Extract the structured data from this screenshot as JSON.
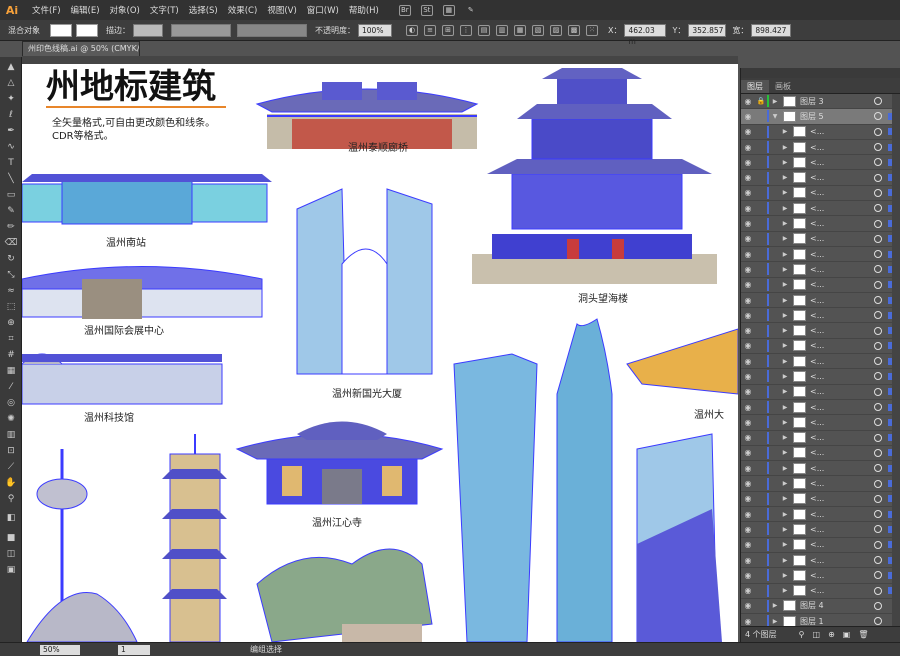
{
  "menubar": {
    "logo": "Ai",
    "items": [
      "文件(F)",
      "编辑(E)",
      "对象(O)",
      "文字(T)",
      "选择(S)",
      "效果(C)",
      "视图(V)",
      "窗口(W)",
      "帮助(H)"
    ],
    "icons": [
      "br-icon",
      "st-icon",
      "grid-icon",
      "brush-icon"
    ]
  },
  "control": {
    "mode_label": "混合对象",
    "stroke_label": "描边：",
    "opacity_label": "不透明度：",
    "opacity_value": "100%",
    "x_label": "X：",
    "x_value": "462.03 m",
    "y_label": "Y：",
    "y_value": "352.857",
    "w_label": "宽：",
    "w_value": "898.427"
  },
  "document": {
    "tab_title": "州印色线稿.ai @ 50% (CMYK/预览)"
  },
  "canvas": {
    "title": "州地标建筑",
    "subtitle_line1": "全矢量格式,可自由更改颜色和线条。",
    "subtitle_line2": "CDR等格式。",
    "labels": [
      "温州泰顺廊桥",
      "温州南站",
      "温州国际会展中心",
      "温州新国光大厦",
      "温州科技馆",
      "温州江心寺",
      "洞头望海楼",
      "温州大"
    ]
  },
  "layers_panel": {
    "tabs": [
      "图层",
      "画板"
    ],
    "rows": [
      {
        "name": "图层 3",
        "depth": 0,
        "expanded": false,
        "selected": false,
        "locked": true,
        "color": "#27c23a"
      },
      {
        "name": "图层 5",
        "depth": 0,
        "expanded": true,
        "selected": true,
        "locked": false,
        "color": "#4a6bd8"
      },
      {
        "name": "<...",
        "depth": 1,
        "expanded": false,
        "selected": false,
        "locked": false,
        "color": "#4a6bd8"
      },
      {
        "name": "<...",
        "depth": 1,
        "expanded": false,
        "selected": false,
        "locked": false,
        "color": "#4a6bd8"
      },
      {
        "name": "<...",
        "depth": 1,
        "expanded": false,
        "selected": false,
        "locked": false,
        "color": "#4a6bd8"
      },
      {
        "name": "<...",
        "depth": 1,
        "expanded": false,
        "selected": false,
        "locked": false,
        "color": "#4a6bd8"
      },
      {
        "name": "<...",
        "depth": 1,
        "expanded": false,
        "selected": false,
        "locked": false,
        "color": "#4a6bd8"
      },
      {
        "name": "<...",
        "depth": 1,
        "expanded": false,
        "selected": false,
        "locked": false,
        "color": "#4a6bd8"
      },
      {
        "name": "<...",
        "depth": 1,
        "expanded": false,
        "selected": false,
        "locked": false,
        "color": "#4a6bd8"
      },
      {
        "name": "<...",
        "depth": 1,
        "expanded": false,
        "selected": false,
        "locked": false,
        "color": "#4a6bd8"
      },
      {
        "name": "<...",
        "depth": 1,
        "expanded": false,
        "selected": false,
        "locked": false,
        "color": "#4a6bd8"
      },
      {
        "name": "<...",
        "depth": 1,
        "expanded": false,
        "selected": false,
        "locked": false,
        "color": "#4a6bd8"
      },
      {
        "name": "<...",
        "depth": 1,
        "expanded": false,
        "selected": false,
        "locked": false,
        "color": "#4a6bd8"
      },
      {
        "name": "<...",
        "depth": 1,
        "expanded": false,
        "selected": false,
        "locked": false,
        "color": "#4a6bd8"
      },
      {
        "name": "<...",
        "depth": 1,
        "expanded": false,
        "selected": false,
        "locked": false,
        "color": "#4a6bd8"
      },
      {
        "name": "<...",
        "depth": 1,
        "expanded": false,
        "selected": false,
        "locked": false,
        "color": "#4a6bd8"
      },
      {
        "name": "<...",
        "depth": 1,
        "expanded": false,
        "selected": false,
        "locked": false,
        "color": "#4a6bd8"
      },
      {
        "name": "<...",
        "depth": 1,
        "expanded": false,
        "selected": false,
        "locked": false,
        "color": "#4a6bd8"
      },
      {
        "name": "<...",
        "depth": 1,
        "expanded": false,
        "selected": false,
        "locked": false,
        "color": "#4a6bd8"
      },
      {
        "name": "<...",
        "depth": 1,
        "expanded": false,
        "selected": false,
        "locked": false,
        "color": "#4a6bd8"
      },
      {
        "name": "<...",
        "depth": 1,
        "expanded": false,
        "selected": false,
        "locked": false,
        "color": "#4a6bd8"
      },
      {
        "name": "<...",
        "depth": 1,
        "expanded": false,
        "selected": false,
        "locked": false,
        "color": "#4a6bd8"
      },
      {
        "name": "<...",
        "depth": 1,
        "expanded": false,
        "selected": false,
        "locked": false,
        "color": "#4a6bd8"
      },
      {
        "name": "<...",
        "depth": 1,
        "expanded": false,
        "selected": false,
        "locked": false,
        "color": "#4a6bd8"
      },
      {
        "name": "<...",
        "depth": 1,
        "expanded": false,
        "selected": false,
        "locked": false,
        "color": "#4a6bd8"
      },
      {
        "name": "<...",
        "depth": 1,
        "expanded": false,
        "selected": false,
        "locked": false,
        "color": "#4a6bd8"
      },
      {
        "name": "<...",
        "depth": 1,
        "expanded": false,
        "selected": false,
        "locked": false,
        "color": "#4a6bd8"
      },
      {
        "name": "<...",
        "depth": 1,
        "expanded": false,
        "selected": false,
        "locked": false,
        "color": "#4a6bd8"
      },
      {
        "name": "<...",
        "depth": 1,
        "expanded": false,
        "selected": false,
        "locked": false,
        "color": "#4a6bd8"
      },
      {
        "name": "<...",
        "depth": 1,
        "expanded": false,
        "selected": false,
        "locked": false,
        "color": "#4a6bd8"
      },
      {
        "name": "<...",
        "depth": 1,
        "expanded": false,
        "selected": false,
        "locked": false,
        "color": "#4a6bd8"
      },
      {
        "name": "<...",
        "depth": 1,
        "expanded": false,
        "selected": false,
        "locked": false,
        "color": "#4a6bd8"
      },
      {
        "name": "<...",
        "depth": 1,
        "expanded": false,
        "selected": false,
        "locked": false,
        "color": "#4a6bd8"
      },
      {
        "name": "图层 4",
        "depth": 0,
        "expanded": false,
        "selected": false,
        "locked": false,
        "color": "#4a6bd8"
      },
      {
        "name": "图层 1",
        "depth": 0,
        "expanded": false,
        "selected": false,
        "locked": false,
        "color": "#4a6bd8"
      }
    ],
    "footer_count": "4 个图层"
  },
  "status": {
    "zoom": "50%",
    "page": "1",
    "message": "编组选择"
  }
}
